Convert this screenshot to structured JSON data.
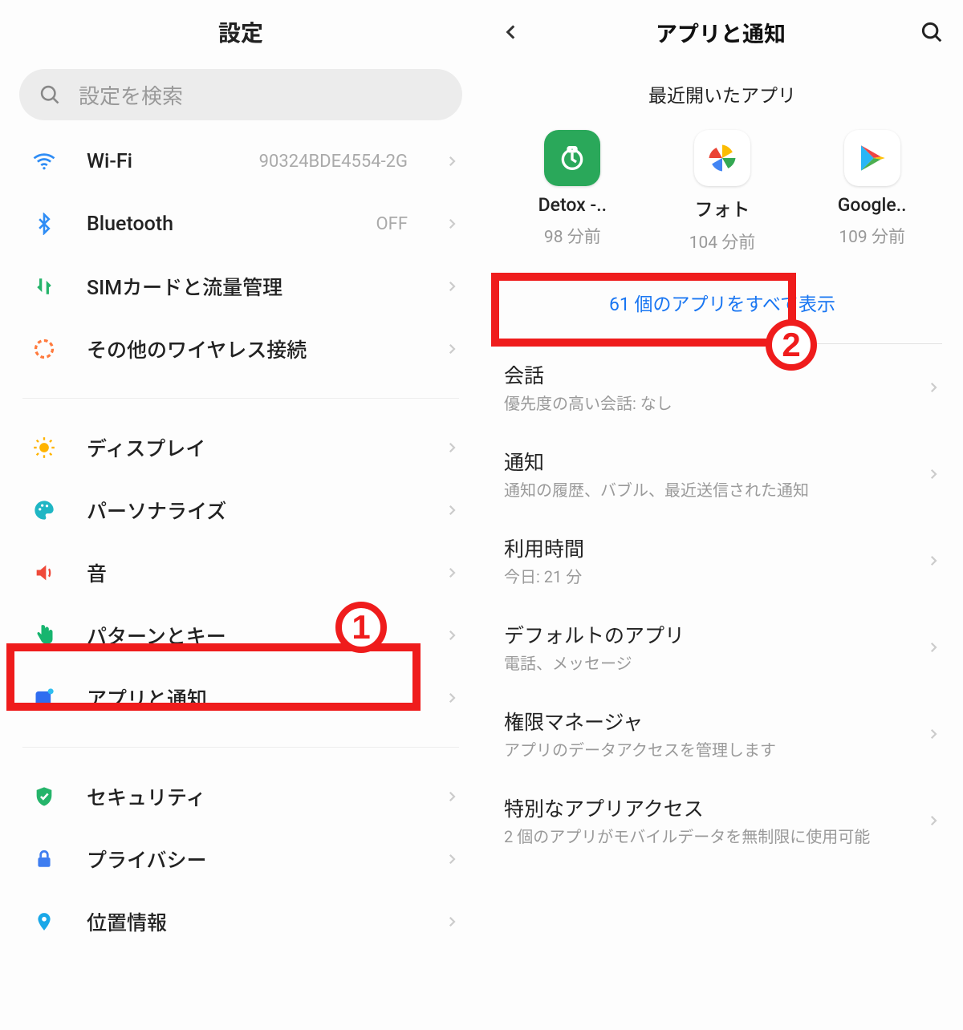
{
  "colors": {
    "annotation": "#ef1c1c",
    "link": "#1976f2"
  },
  "left": {
    "title": "設定",
    "search_placeholder": "設定を検索",
    "items": [
      {
        "icon": "wifi",
        "label": "Wi-Fi",
        "value": "90324BDE4554-2G"
      },
      {
        "icon": "bluetooth",
        "label": "Bluetooth",
        "value": "OFF"
      },
      {
        "icon": "sim",
        "label": "SIMカードと流量管理",
        "value": ""
      },
      {
        "icon": "wireless",
        "label": "その他のワイヤレス接続",
        "value": ""
      }
    ],
    "items2": [
      {
        "icon": "sun",
        "label": "ディスプレイ"
      },
      {
        "icon": "palette",
        "label": "パーソナライズ"
      },
      {
        "icon": "sound",
        "label": "音"
      },
      {
        "icon": "hand",
        "label": "パターンとキー"
      },
      {
        "icon": "apps",
        "label": "アプリと通知"
      }
    ],
    "items3": [
      {
        "icon": "shield",
        "label": "セキュリティ"
      },
      {
        "icon": "lock",
        "label": "プライバシー"
      },
      {
        "icon": "location",
        "label": "位置情報"
      }
    ]
  },
  "right": {
    "title": "アプリと通知",
    "recent_title": "最近開いたアプリ",
    "recent": [
      {
        "name": "Detox -..",
        "time": "98 分前",
        "icon": "detox"
      },
      {
        "name": "フォト",
        "time": "104 分前",
        "icon": "photos"
      },
      {
        "name": "Google..",
        "time": "109 分前",
        "icon": "play"
      }
    ],
    "show_all": "61 個のアプリをすべて表示",
    "rows": [
      {
        "title": "会話",
        "sub": "優先度の高い会話: なし"
      },
      {
        "title": "通知",
        "sub": "通知の履歴、バブル、最近送信された通知"
      },
      {
        "title": "利用時間",
        "sub": "今日: 21 分"
      },
      {
        "title": "デフォルトのアプリ",
        "sub": "電話、メッセージ"
      },
      {
        "title": "権限マネージャ",
        "sub": "アプリのデータアクセスを管理します"
      },
      {
        "title": "特別なアプリアクセス",
        "sub": "2 個のアプリがモバイルデータを無制限に使用可能"
      }
    ]
  },
  "annotations": {
    "1": "1",
    "2": "2"
  }
}
